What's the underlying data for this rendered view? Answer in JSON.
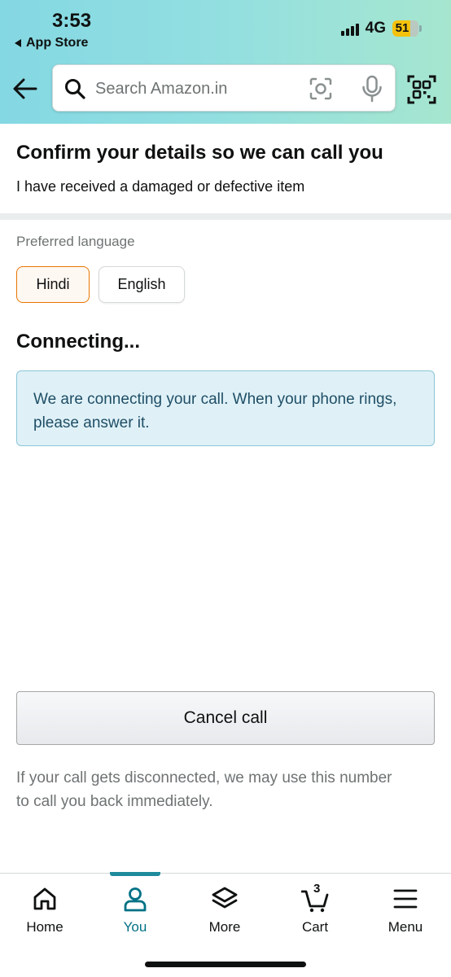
{
  "status_bar": {
    "time": "3:53",
    "back_app": "App Store",
    "network": "4G",
    "battery": "51"
  },
  "header": {
    "search_placeholder": "Search Amazon.in"
  },
  "content": {
    "title": "Confirm your details so we can call you",
    "issue": "I have received a damaged or defective item",
    "preferred_language_label": "Preferred language",
    "languages": [
      {
        "label": "Hindi",
        "selected": true
      },
      {
        "label": "English",
        "selected": false
      }
    ],
    "connecting_heading": "Connecting...",
    "info_message": "We are connecting your call. When your phone rings, please answer it.",
    "cancel_button": "Cancel call",
    "disclaimer": "If your call gets disconnected, we may use this number to call you back immediately."
  },
  "bottom_nav": {
    "items": [
      {
        "label": "Home",
        "icon": "home-icon"
      },
      {
        "label": "You",
        "icon": "person-icon",
        "active": true
      },
      {
        "label": "More",
        "icon": "layers-icon"
      },
      {
        "label": "Cart",
        "icon": "cart-icon",
        "count": "3"
      },
      {
        "label": "Menu",
        "icon": "hamburger-icon"
      }
    ]
  },
  "colors": {
    "accent": "#007185",
    "selected_border": "#e77600",
    "info_bg": "#dff1f7"
  }
}
